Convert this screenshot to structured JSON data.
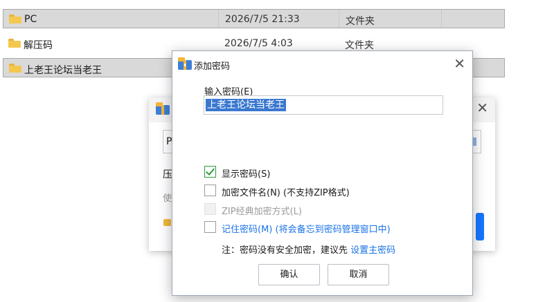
{
  "file_list": {
    "rows": [
      {
        "name": "PC",
        "date": "2026/7/5 21:33",
        "type": "文件夹",
        "selected": true
      },
      {
        "name": "解压码",
        "date": "2026/7/5 4:03",
        "type": "文件夹",
        "selected": false
      },
      {
        "name": "上老王论坛当老王",
        "date": "",
        "type": "",
        "selected": true
      }
    ]
  },
  "background_dialog": {
    "input_text": "P",
    "label_1": "压",
    "label_2": "使"
  },
  "dialog": {
    "title": "添加密码",
    "password_label": "输入密码(E)",
    "password_value": "上老王论坛当老王",
    "options": {
      "show_password": {
        "label": "显示密码(S)",
        "checked": true
      },
      "encrypt_filename": {
        "label": "加密文件名(N) (不支持ZIP格式)",
        "checked": false
      },
      "zip_classic": {
        "label": "ZIP经典加密方式(L)",
        "checked": false,
        "disabled": true
      },
      "remember_password": {
        "label": "记住密码(M) (将会备忘到密码管理窗口中)",
        "checked": false
      }
    },
    "note_text": "注：密码没有安全加密，建议先 ",
    "note_link": "设置主密码",
    "ok_label": "确认",
    "cancel_label": "取消"
  },
  "colors": {
    "accent_blue": "#1a73e8",
    "check_green": "#2d9c3c",
    "selection_blue": "#3a78d0",
    "folder_yellow": "#f4c84f"
  }
}
